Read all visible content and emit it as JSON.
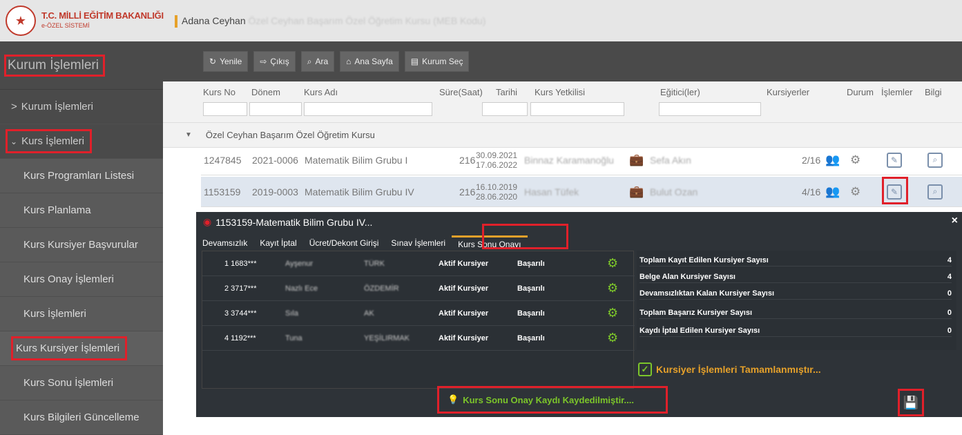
{
  "header": {
    "logo_title": "T.C. MİLLİ EĞİTİM BAKANLIĞI",
    "logo_sub": "e-ÖZEL SİSTEMİ",
    "institution": "Adana Ceyhan",
    "institution_blurred": "Özel Ceyhan Başarım Özel Öğretim Kursu (MEB Kodu)"
  },
  "sidebar": {
    "title": "Kurum İşlemleri",
    "items": [
      {
        "label": "Kurum İşlemleri",
        "prefix": ">"
      },
      {
        "label": "Kurs İşlemleri",
        "prefix": "⌄"
      },
      {
        "label": "Kurs Programları Listesi"
      },
      {
        "label": "Kurs Planlama"
      },
      {
        "label": "Kurs Kursiyer Başvurular"
      },
      {
        "label": "Kurs Onay İşlemleri"
      },
      {
        "label": "Kurs İşlemleri"
      },
      {
        "label": "Kurs Kursiyer İşlemleri"
      },
      {
        "label": "Kurs Sonu İşlemleri"
      },
      {
        "label": "Kurs Bilgileri Güncelleme"
      }
    ]
  },
  "toolbar": {
    "refresh": "Yenile",
    "exit": "Çıkış",
    "search": "Ara",
    "home": "Ana Sayfa",
    "select": "Kurum Seç"
  },
  "grid": {
    "columns": [
      "Kurs No",
      "Dönem",
      "Kurs Adı",
      "Süre(Saat)",
      "Tarihi",
      "Kurs Yetkilisi",
      "Eğitici(ler)",
      "Kursiyerler",
      "Durum",
      "İşlemler",
      "Bilgi"
    ],
    "group": "Özel Ceyhan Başarım Özel Öğretim Kursu",
    "rows": [
      {
        "no": "1247845",
        "period": "2021-0006",
        "name": "Matematik Bilim Grubu I",
        "hours": "216",
        "start": "30.09.2021",
        "end": "17.06.2022",
        "manager": "Binnaz Karamanoğlu",
        "trainer": "Sefa Akın",
        "students": "2/16"
      },
      {
        "no": "1153159",
        "period": "2019-0003",
        "name": "Matematik Bilim Grubu IV",
        "hours": "216",
        "start": "16.10.2019",
        "end": "28.06.2020",
        "manager": "Hasan Tüfek",
        "trainer": "Bulut Ozan",
        "students": "4/16"
      }
    ]
  },
  "dialog": {
    "title": "1153159-Matematik Bilim Grubu IV...",
    "close": "×",
    "tabs": [
      "Devamsızlık",
      "Kayıt İptal",
      "Ücret/Dekont Girişi",
      "Sınav İşlemleri",
      "Kurs Sonu Onayı"
    ],
    "students": [
      {
        "idx": "1 1683***",
        "first": "Ayşenur",
        "last": "TÜRK",
        "status": "Aktif Kursiyer",
        "result": "Başarılı"
      },
      {
        "idx": "2 3717***",
        "first": "Nazlı Ece",
        "last": "ÖZDEMİR",
        "status": "Aktif Kursiyer",
        "result": "Başarılı"
      },
      {
        "idx": "3 3744***",
        "first": "Sıla",
        "last": "AK",
        "status": "Aktif Kursiyer",
        "result": "Başarılı"
      },
      {
        "idx": "4 1192***",
        "first": "Tuna",
        "last": "YEŞİLIRMAK",
        "status": "Aktif Kursiyer",
        "result": "Başarılı"
      }
    ],
    "stats": [
      {
        "label": "Toplam Kayıt Edilen Kursiyer Sayısı",
        "value": "4"
      },
      {
        "label": "Belge Alan Kursiyer Sayısı",
        "value": "4"
      },
      {
        "label": "Devamsızlıktan Kalan Kursiyer Sayısı",
        "value": "0"
      },
      {
        "label": "Toplam Başarız Kursiyer Sayısı",
        "value": "0"
      },
      {
        "label": "Kaydı İptal Edilen Kursiyer Sayısı",
        "value": "0"
      }
    ],
    "done_message": "Kursiyer İşlemleri Tamamlanmıştır...",
    "saved_message": "Kurs Sonu Onay Kaydı Kaydedilmiştir...."
  },
  "colors": {
    "accent": "#e6a12a",
    "highlight": "#e0202a",
    "success": "#7cc52a"
  }
}
